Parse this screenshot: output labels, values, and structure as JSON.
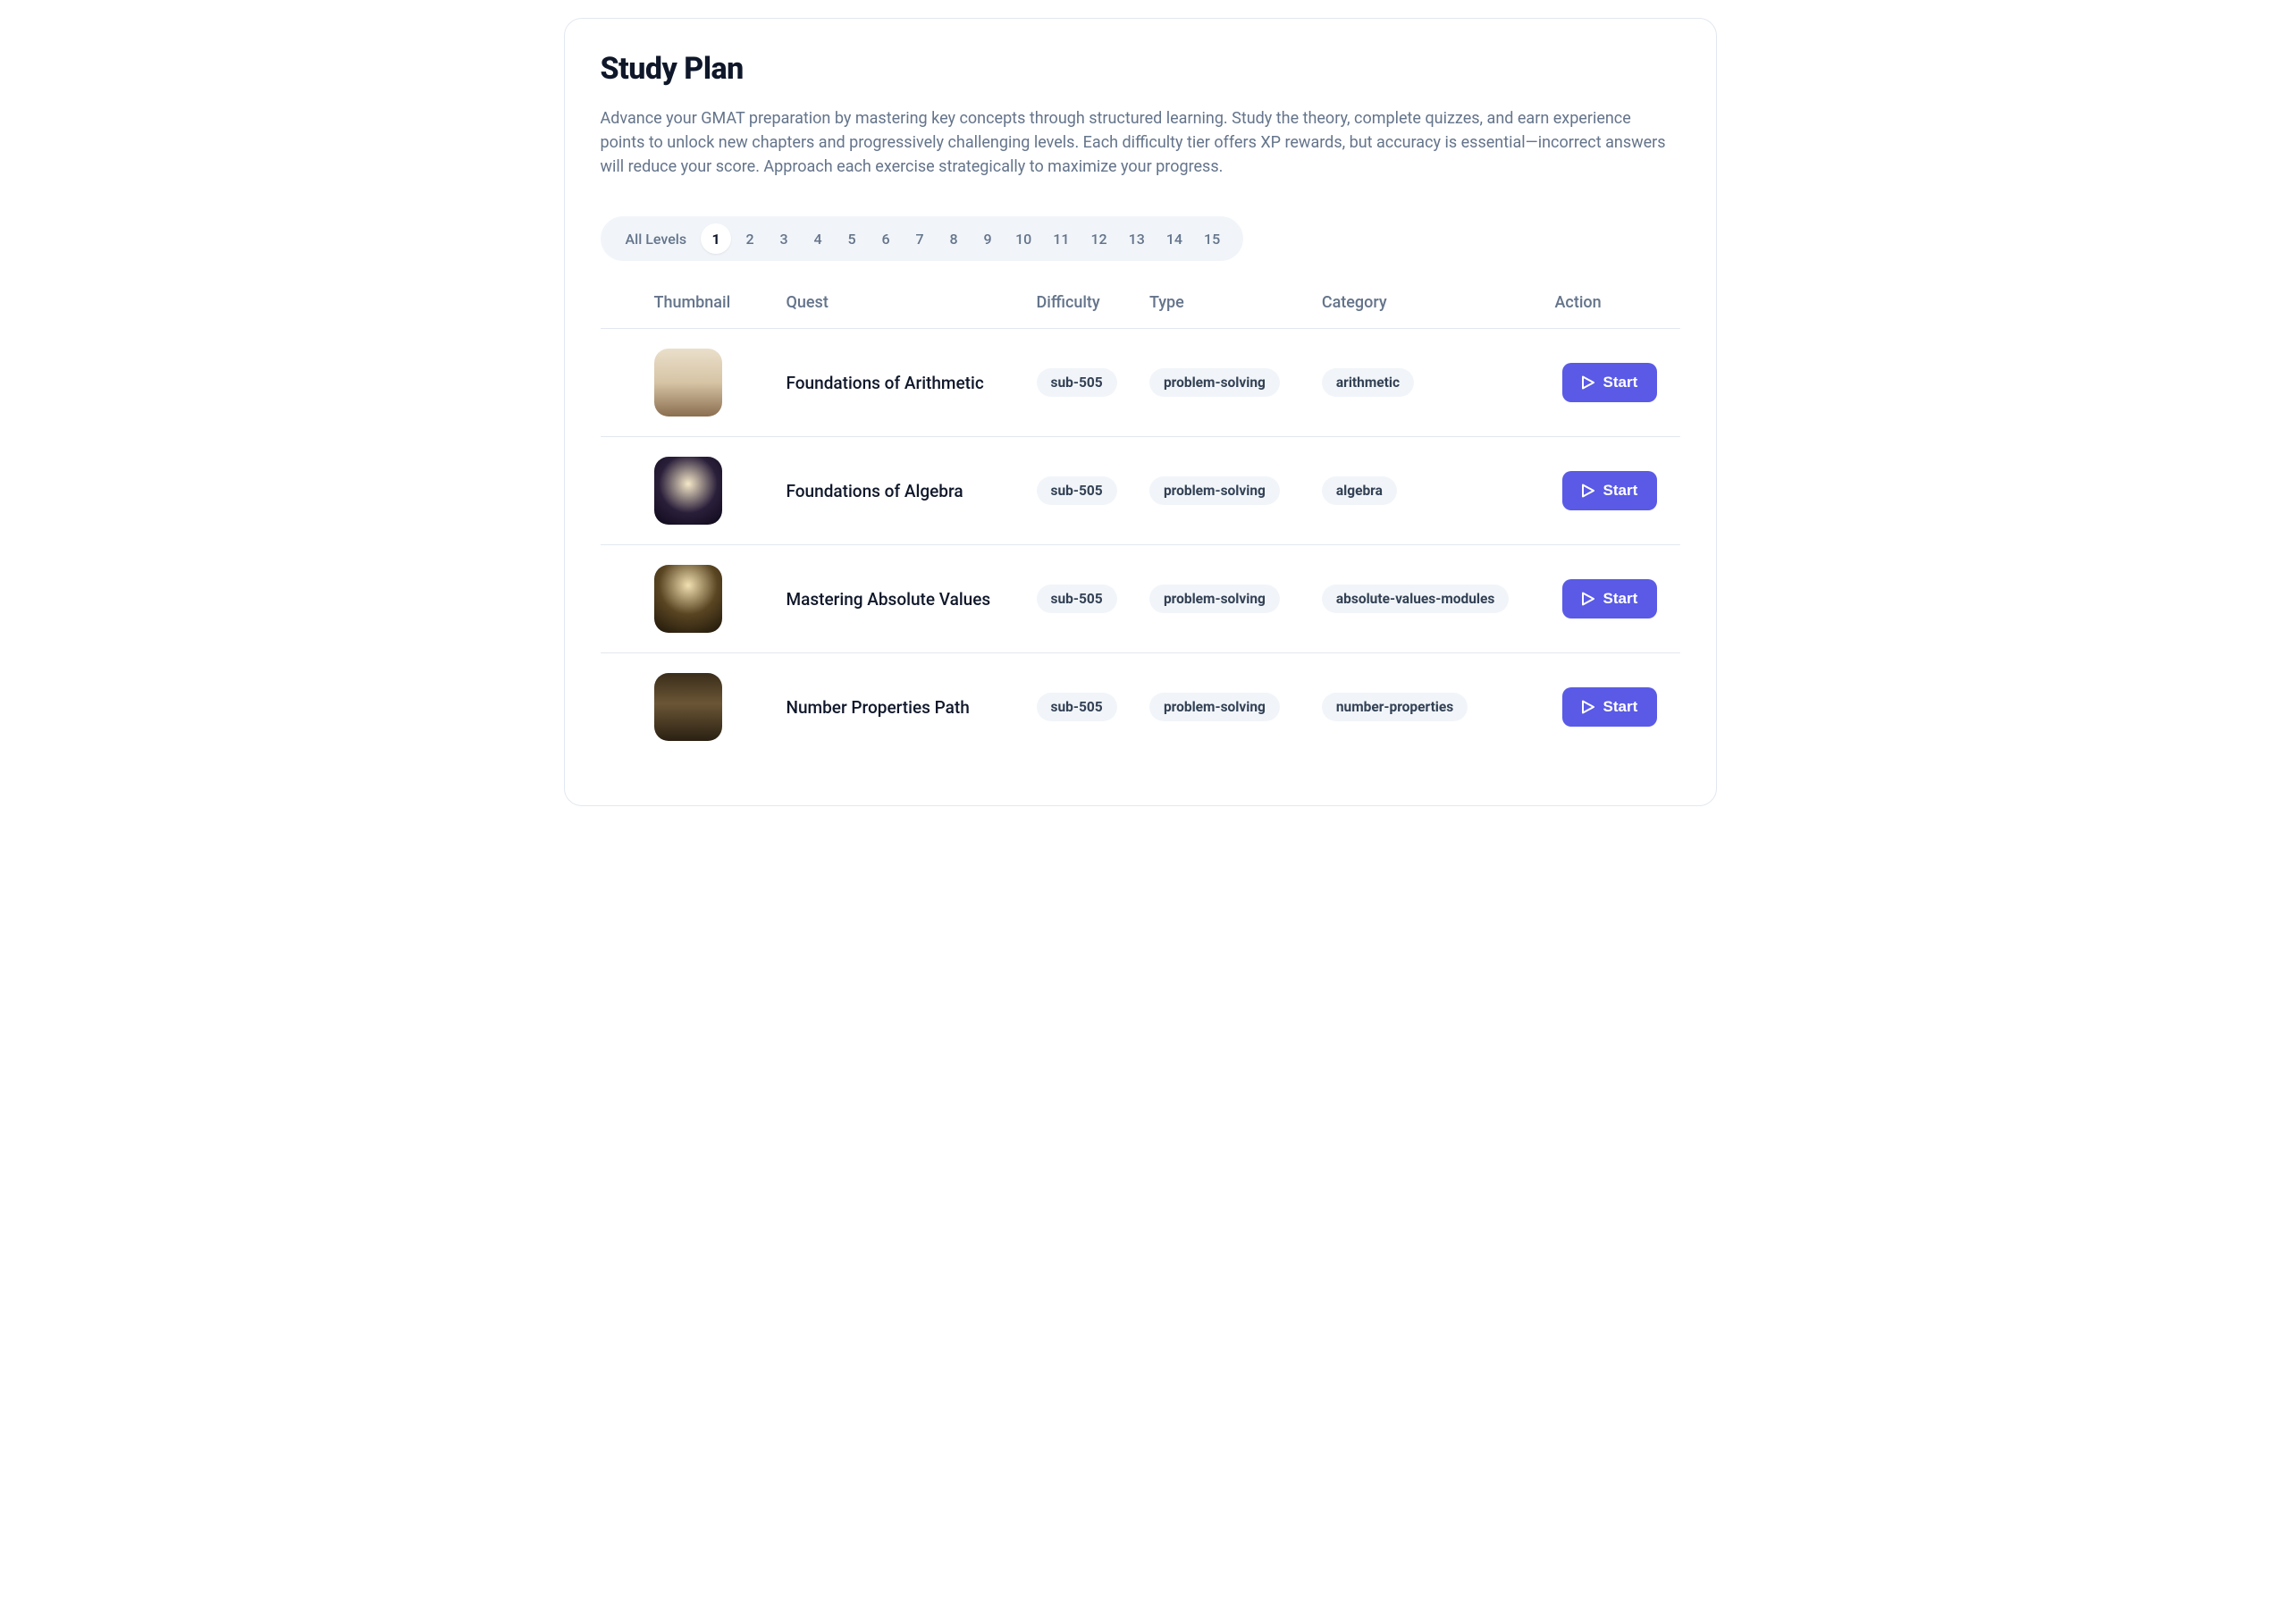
{
  "title": "Study Plan",
  "description": "Advance your GMAT preparation by mastering key concepts through structured learning. Study the theory, complete quizzes, and earn experience points to unlock new chapters and progressively challenging levels. Each difficulty tier offers XP rewards, but accuracy is essential—incorrect answers will reduce your score. Approach each exercise strategically to maximize your progress.",
  "tabs": {
    "all_label": "All Levels",
    "levels": [
      "1",
      "2",
      "3",
      "4",
      "5",
      "6",
      "7",
      "8",
      "9",
      "10",
      "11",
      "12",
      "13",
      "14",
      "15"
    ],
    "active": "1"
  },
  "columns": {
    "thumbnail": "Thumbnail",
    "quest": "Quest",
    "difficulty": "Difficulty",
    "type": "Type",
    "category": "Category",
    "action": "Action"
  },
  "action_label": "Start",
  "rows": [
    {
      "quest": "Foundations of Arithmetic",
      "difficulty": "sub-505",
      "type": "problem-solving",
      "category": "arithmetic",
      "thumb_class": "t1"
    },
    {
      "quest": "Foundations of Algebra",
      "difficulty": "sub-505",
      "type": "problem-solving",
      "category": "algebra",
      "thumb_class": "t2"
    },
    {
      "quest": "Mastering Absolute Values",
      "difficulty": "sub-505",
      "type": "problem-solving",
      "category": "absolute-values-modules",
      "thumb_class": "t3"
    },
    {
      "quest": "Number Properties Path",
      "difficulty": "sub-505",
      "type": "problem-solving",
      "category": "number-properties",
      "thumb_class": "t4"
    }
  ]
}
